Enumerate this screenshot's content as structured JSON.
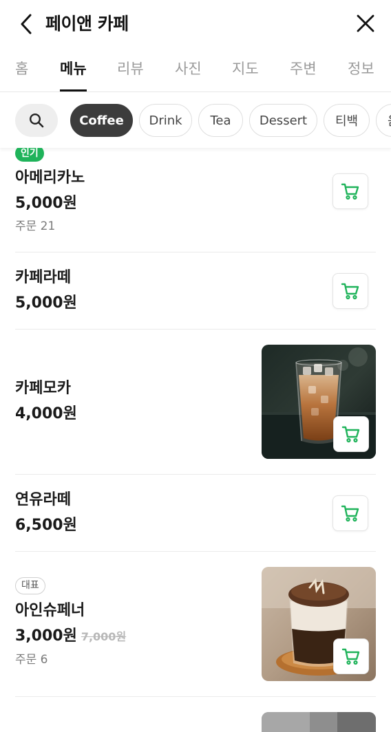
{
  "header": {
    "title": "페이앤 카페"
  },
  "tabs": [
    {
      "label": "홈"
    },
    {
      "label": "메뉴"
    },
    {
      "label": "리뷰"
    },
    {
      "label": "사진"
    },
    {
      "label": "지도"
    },
    {
      "label": "주변"
    },
    {
      "label": "정보"
    }
  ],
  "active_tab": "메뉴",
  "categories": [
    {
      "label": "Coffee"
    },
    {
      "label": "Drink"
    },
    {
      "label": "Tea"
    },
    {
      "label": "Dessert"
    },
    {
      "label": "티백"
    },
    {
      "label": "음"
    }
  ],
  "active_category": "Coffee",
  "menu": [
    {
      "badge": "인기",
      "name": "아메리카노",
      "price": "5,000원",
      "orders": "주문 21",
      "has_image": false
    },
    {
      "name": "카페라떼",
      "price": "5,000원",
      "has_image": false
    },
    {
      "name": "카페모카",
      "price": "4,000원",
      "has_image": true,
      "image": "iced-mocha-glass-photo"
    },
    {
      "name": "연유라떼",
      "price": "6,500원",
      "has_image": false
    },
    {
      "badge": "대표",
      "name": "아인슈페너",
      "price": "3,000원",
      "original_price": "7,000원",
      "orders": "주문 6",
      "has_image": true,
      "image": "einspanner-cream-glass-photo"
    }
  ],
  "colors": {
    "accent_green": "#1fb35a",
    "active_chip": "#3c3c3c",
    "inactive_tab": "#9a9a9a",
    "strikethrough_price": "#b8b8b8"
  }
}
